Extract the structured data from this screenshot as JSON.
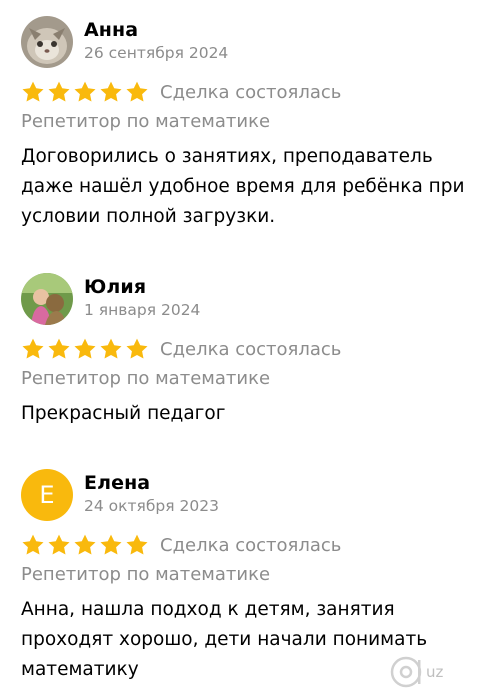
{
  "reviews": [
    {
      "name": "Анна",
      "date": "26 сентября 2024",
      "rating": 5,
      "deal": "Сделка состоялась",
      "category": "Репетитор по математике",
      "text": "Договорились о занятиях, преподаватель даже нашёл удобное время для ребёнка при условии полной загрузки."
    },
    {
      "name": "Юлия",
      "date": "1 января 2024",
      "rating": 5,
      "deal": "Сделка состоялась",
      "category": "Репетитор по математике",
      "text": "Прекрасный педагог"
    },
    {
      "name": "Елена",
      "avatar_letter": "Е",
      "date": "24 октября 2023",
      "rating": 5,
      "deal": "Сделка состоялась",
      "category": "Репетитор по математике",
      "text": "Анна, нашла подход к детям, занятия проходят хорошо, дети начали понимать математику"
    }
  ],
  "colors": {
    "star": "#f9b90d",
    "avatar_letter_bg": "#f9b90d",
    "secondary_text": "#8c8c8c"
  },
  "watermark": {
    "text": "uz"
  }
}
